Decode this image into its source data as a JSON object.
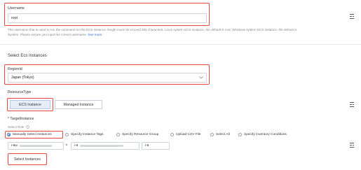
{
  "username": {
    "label": "Username",
    "value": "root",
    "help_text": "The username that is used to run the command on the ECS instance. length must not exceed 255 characters. Linux system ECS instance, the default is root. Windows system ECS instance, the default is",
    "help_text_2": "System. Please ensure you input the correct username.",
    "see_more": "See more"
  },
  "section_title": "Select Ecs Instances",
  "region": {
    "label": "RegionId",
    "value": "Japan (Tokyo)"
  },
  "resource_type": {
    "label": "ResourceType",
    "options": [
      "ECS Instance",
      "Managed Instance"
    ],
    "selected": "ECS Instance"
  },
  "target_instance": {
    "label": "* TargetInstance",
    "select_role_label": "Select Role",
    "role_options": [
      "Manually Select Instances",
      "Specify Instance Tags",
      "Specify Resource Group",
      "Upload CSV File",
      "Select All",
      "Specify Inventory Conditions"
    ],
    "selected_role": "Manually Select Instances",
    "instance_chips": [
      "i-6w",
      "i-6",
      "i-6"
    ],
    "select_button": "Select Instances"
  },
  "colors": {
    "highlight": "#e8453c",
    "accent": "#2b6fd6",
    "selected_bg": "#e6edf8"
  }
}
